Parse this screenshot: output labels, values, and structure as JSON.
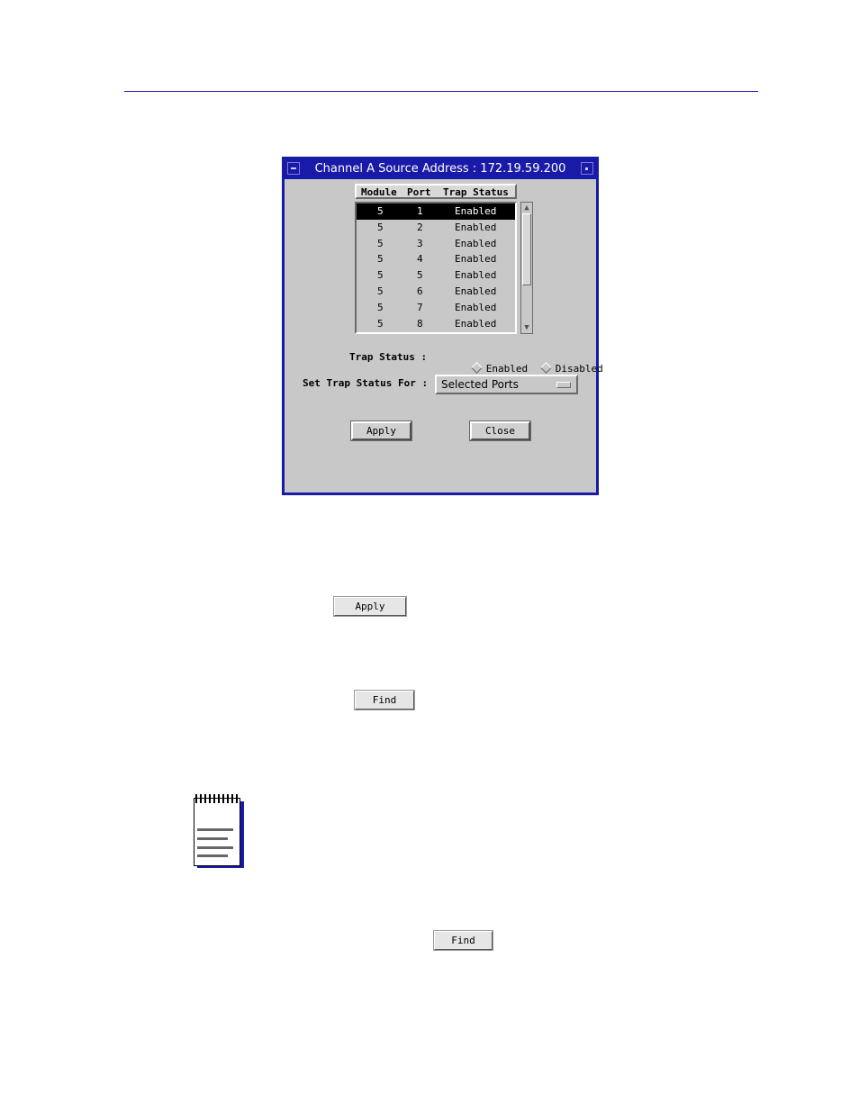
{
  "dialog": {
    "title": "Channel A Source Address : 172.19.59.200",
    "list_headers": [
      "Module",
      "Port",
      "Trap Status"
    ],
    "rows": [
      {
        "module": "5",
        "port": "1",
        "trap": "Enabled",
        "selected": true
      },
      {
        "module": "5",
        "port": "2",
        "trap": "Enabled"
      },
      {
        "module": "5",
        "port": "3",
        "trap": "Enabled"
      },
      {
        "module": "5",
        "port": "4",
        "trap": "Enabled"
      },
      {
        "module": "5",
        "port": "5",
        "trap": "Enabled"
      },
      {
        "module": "5",
        "port": "6",
        "trap": "Enabled"
      },
      {
        "module": "5",
        "port": "7",
        "trap": "Enabled"
      },
      {
        "module": "5",
        "port": "8",
        "trap": "Enabled"
      }
    ],
    "trap_status_label": "Trap Status :",
    "radio_enabled": "Enabled",
    "radio_disabled": "Disabled",
    "set_trap_label": "Set Trap Status For :",
    "set_trap_value": "Selected Ports",
    "apply_label": "Apply",
    "close_label": "Close"
  },
  "inline_buttons": {
    "apply": "Apply",
    "find_1": "Find",
    "find_2": "Find"
  },
  "colors": {
    "title_bar": "#1a1aa8",
    "header_rule": "#1a1ab0",
    "dialog_bg": "#c8c8c8",
    "selected_row": "#000000"
  },
  "icons": [
    "note-icon"
  ]
}
